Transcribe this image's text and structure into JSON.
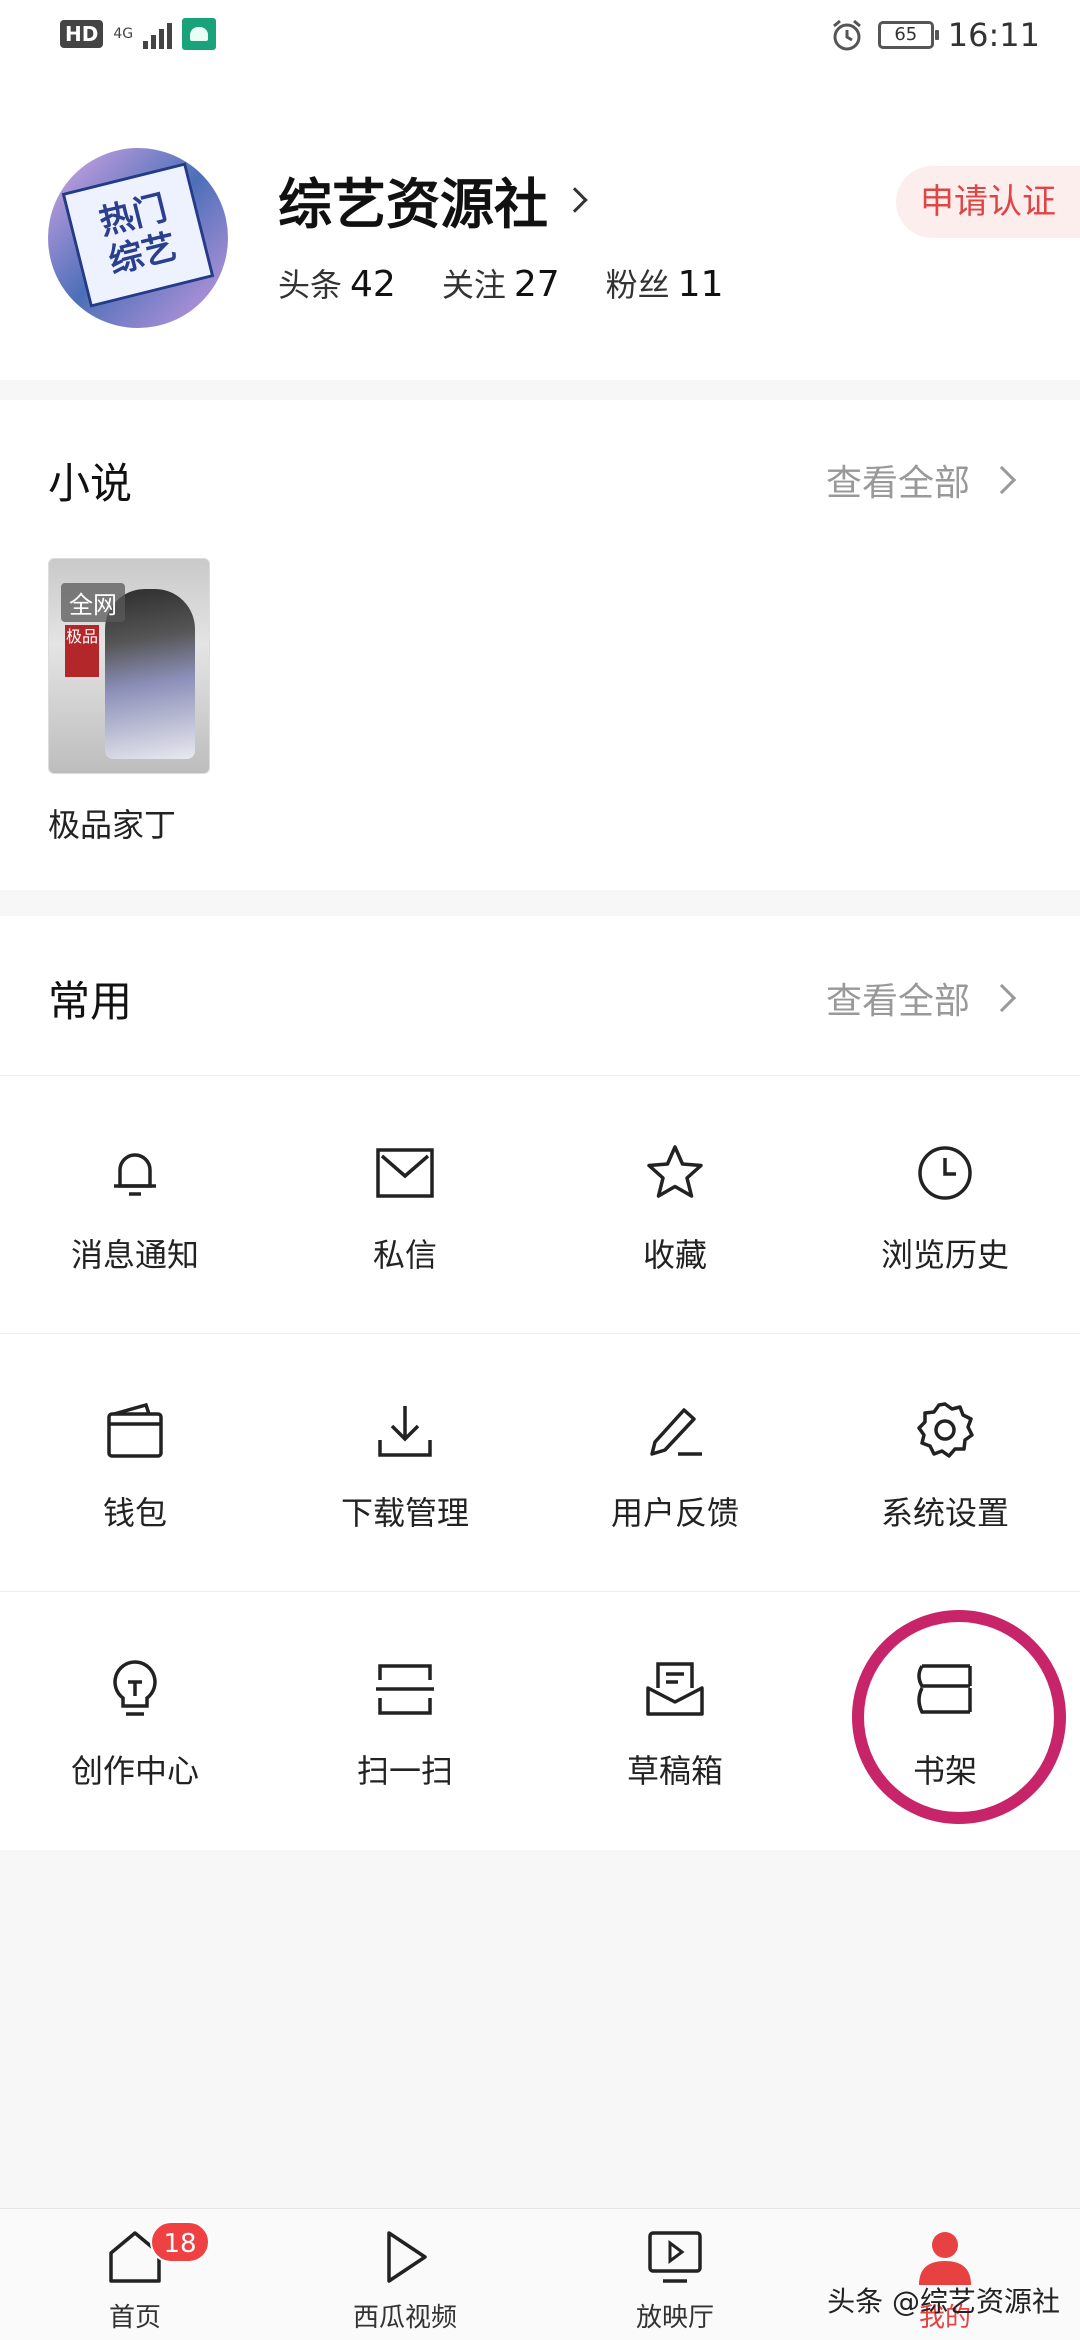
{
  "status_bar": {
    "hd": "HD",
    "network": "4G",
    "battery": "65",
    "time": "16:11",
    "icons": [
      "signal-icon",
      "android-icon",
      "alarm-icon",
      "battery-icon"
    ]
  },
  "profile": {
    "avatar_text_line1": "热门",
    "avatar_text_line2": "综艺",
    "name": "综艺资源社",
    "stats": {
      "headlines_label": "头条",
      "headlines_value": "42",
      "following_label": "关注",
      "following_value": "27",
      "fans_label": "粉丝",
      "fans_value": "11"
    },
    "verify_label": "申请认证"
  },
  "novels": {
    "title": "小说",
    "view_all": "查看全部",
    "books": [
      {
        "title": "极品家丁",
        "badge": "全网",
        "stamp": "极品"
      }
    ]
  },
  "common": {
    "title": "常用",
    "view_all": "查看全部",
    "items": [
      {
        "label": "消息通知",
        "icon": "bell-icon"
      },
      {
        "label": "私信",
        "icon": "mail-icon"
      },
      {
        "label": "收藏",
        "icon": "star-icon"
      },
      {
        "label": "浏览历史",
        "icon": "clock-icon"
      },
      {
        "label": "钱包",
        "icon": "wallet-icon"
      },
      {
        "label": "下载管理",
        "icon": "download-icon"
      },
      {
        "label": "用户反馈",
        "icon": "pen-icon"
      },
      {
        "label": "系统设置",
        "icon": "gear-icon"
      },
      {
        "label": "创作中心",
        "icon": "lightbulb-icon"
      },
      {
        "label": "扫一扫",
        "icon": "scan-icon"
      },
      {
        "label": "草稿箱",
        "icon": "drafts-icon"
      },
      {
        "label": "书架",
        "icon": "bookshelf-icon"
      }
    ]
  },
  "bottom_nav": {
    "items": [
      {
        "label": "首页",
        "icon": "home-icon",
        "badge": "18"
      },
      {
        "label": "西瓜视频",
        "icon": "play-icon"
      },
      {
        "label": "放映厅",
        "icon": "tv-icon"
      },
      {
        "label": "我的",
        "icon": "user-icon",
        "active": true
      }
    ]
  },
  "watermark": "头条 @综艺资源社",
  "colors": {
    "accent": "#e84142",
    "highlight_ring": "#c8246a",
    "muted": "#999999"
  }
}
